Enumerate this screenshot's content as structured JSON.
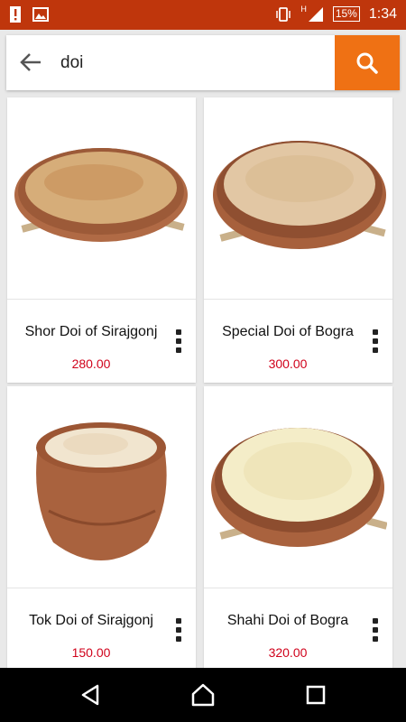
{
  "status_bar": {
    "network": "H",
    "battery": "15%",
    "time": "1:34",
    "icons": [
      "alert-icon",
      "image-icon",
      "vibrate-icon",
      "signal-icon",
      "battery-icon"
    ]
  },
  "search": {
    "query": "doi",
    "icons": [
      "back-arrow-icon",
      "search-icon"
    ],
    "accent_color": "#ef7114"
  },
  "products": [
    {
      "name": "Shor Doi of Sirajgonj",
      "price": "280.00"
    },
    {
      "name": "Special Doi of Bogra",
      "price": "300.00"
    },
    {
      "name": "Tok Doi of Sirajgonj",
      "price": "150.00"
    },
    {
      "name": "Shahi Doi of Bogra",
      "price": "320.00"
    }
  ],
  "colors": {
    "status_bar": "#bf360c",
    "price": "#d0021b"
  },
  "nav": {
    "icons": [
      "back-triangle-icon",
      "home-icon",
      "recents-square-icon"
    ]
  }
}
